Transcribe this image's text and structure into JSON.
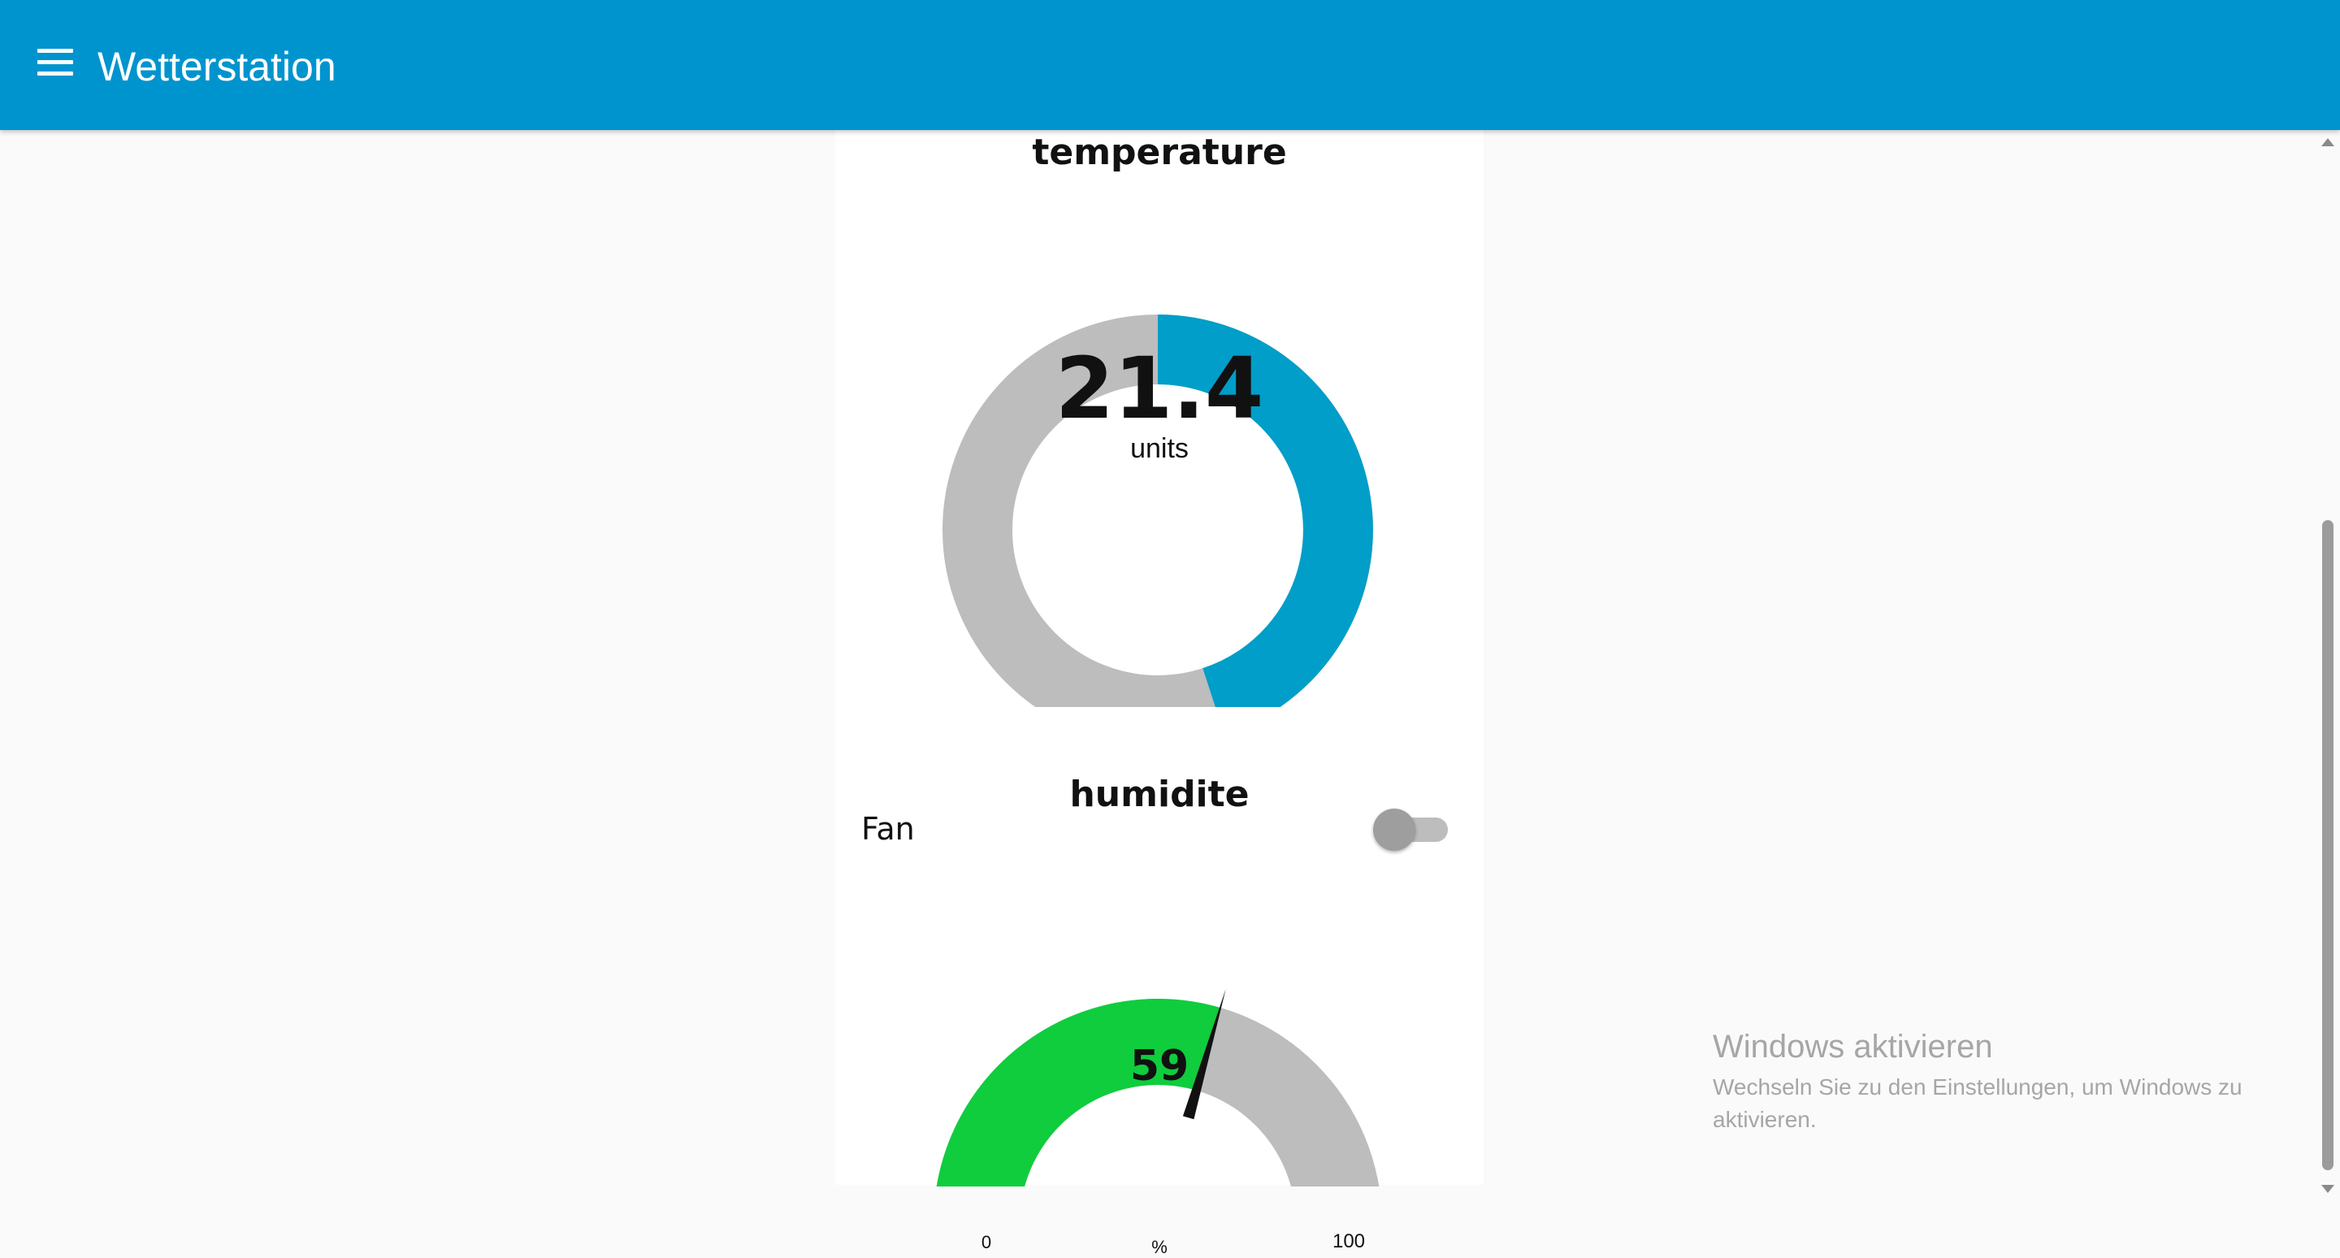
{
  "header": {
    "title": "Wetterstation",
    "menu_icon": "hamburger-icon",
    "background": "#0094ce"
  },
  "temperature": {
    "title": "temperature",
    "value": "21.4",
    "units": "units",
    "fill_fraction": 0.45,
    "fill_color": "#009ec8",
    "track_color": "#bdbdbd"
  },
  "fan": {
    "label": "Fan",
    "state": "off"
  },
  "humidity": {
    "title": "humidite",
    "value": "59",
    "unit": "%",
    "min": "0",
    "max": "100",
    "fraction": 0.59,
    "fill_color": "#0fcd3c",
    "track_color": "#bdbdbd"
  },
  "watermark": {
    "title": "Windows aktivieren",
    "text": "Wechseln Sie zu den Einstellungen, um Windows zu aktivieren."
  }
}
